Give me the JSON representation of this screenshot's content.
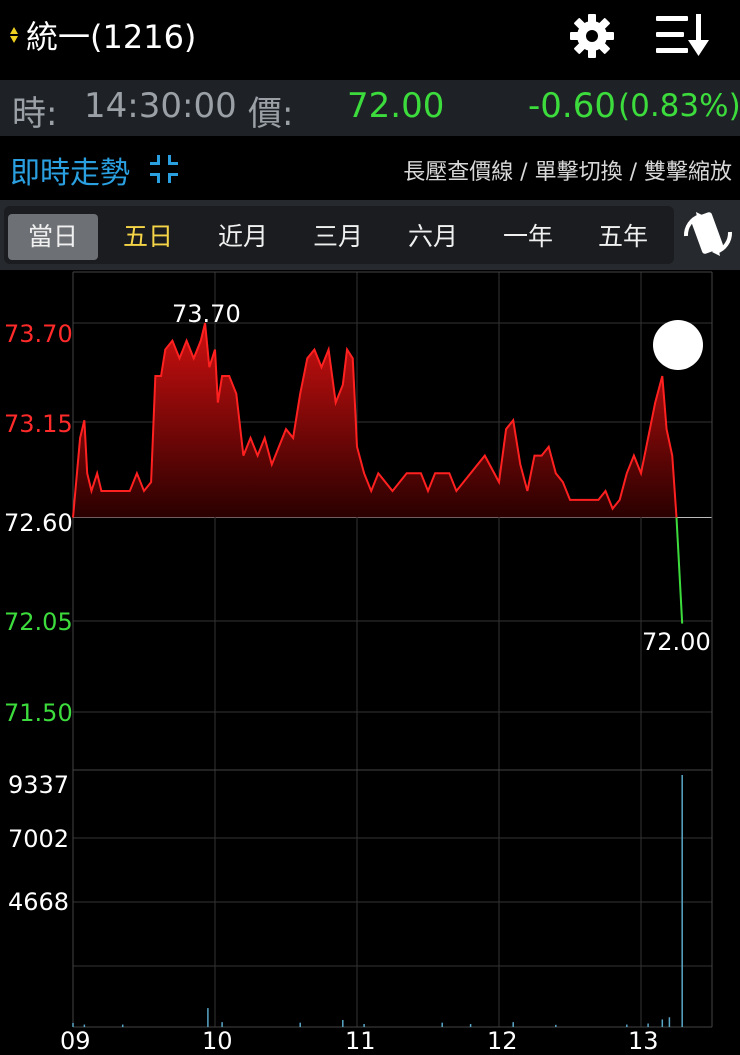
{
  "header": {
    "title": "統一(1216)",
    "icons": {
      "settings": "gear-icon",
      "menu": "sort-list-icon",
      "indicator": "up-down-arrows-icon"
    }
  },
  "quote": {
    "time_label": "時:",
    "time": "14:30:00",
    "price_label": "價:",
    "price": "72.00",
    "change": "-0.60",
    "change_pct": "(0.83%)"
  },
  "mode": {
    "title": "即時走勢",
    "hint": "長壓查價線 / 單擊切換 / 雙擊縮放"
  },
  "tabs": [
    {
      "label": "當日",
      "active": true
    },
    {
      "label": "五日"
    },
    {
      "label": "近月"
    },
    {
      "label": "三月"
    },
    {
      "label": "六月"
    },
    {
      "label": "一年"
    },
    {
      "label": "五年"
    }
  ],
  "colors": {
    "up": "#ff2020",
    "down": "#3ddc3d",
    "ref": "#ffffff",
    "accent": "#2aa0e0",
    "yellow": "#f5d547"
  },
  "chart_data": {
    "type": "line",
    "price_axis": {
      "ticks": [
        "73.70",
        "73.15",
        "72.60",
        "72.05",
        "71.50"
      ],
      "ylim": [
        71.5,
        73.7
      ],
      "reference": 72.6
    },
    "volume_axis": {
      "ticks": [
        "9337",
        "7002",
        "4668"
      ],
      "ylim": [
        0,
        9337
      ]
    },
    "x_ticks": [
      "09",
      "10",
      "11",
      "12",
      "13"
    ],
    "high_label": "73.70",
    "last_label": "72.00",
    "price_series": [
      [
        9.0,
        72.6
      ],
      [
        9.05,
        73.05
      ],
      [
        9.08,
        73.15
      ],
      [
        9.1,
        72.85
      ],
      [
        9.13,
        72.75
      ],
      [
        9.17,
        72.85
      ],
      [
        9.2,
        72.75
      ],
      [
        9.3,
        72.75
      ],
      [
        9.4,
        72.75
      ],
      [
        9.45,
        72.85
      ],
      [
        9.5,
        72.75
      ],
      [
        9.55,
        72.8
      ],
      [
        9.58,
        73.4
      ],
      [
        9.62,
        73.4
      ],
      [
        9.65,
        73.55
      ],
      [
        9.7,
        73.6
      ],
      [
        9.75,
        73.5
      ],
      [
        9.8,
        73.6
      ],
      [
        9.85,
        73.5
      ],
      [
        9.9,
        73.6
      ],
      [
        9.93,
        73.7
      ],
      [
        9.96,
        73.45
      ],
      [
        10.0,
        73.55
      ],
      [
        10.02,
        73.25
      ],
      [
        10.05,
        73.4
      ],
      [
        10.1,
        73.4
      ],
      [
        10.15,
        73.3
      ],
      [
        10.2,
        72.95
      ],
      [
        10.25,
        73.05
      ],
      [
        10.3,
        72.95
      ],
      [
        10.35,
        73.05
      ],
      [
        10.4,
        72.9
      ],
      [
        10.45,
        73.0
      ],
      [
        10.5,
        73.1
      ],
      [
        10.55,
        73.05
      ],
      [
        10.6,
        73.3
      ],
      [
        10.65,
        73.5
      ],
      [
        10.7,
        73.55
      ],
      [
        10.75,
        73.45
      ],
      [
        10.8,
        73.55
      ],
      [
        10.85,
        73.25
      ],
      [
        10.9,
        73.35
      ],
      [
        10.93,
        73.55
      ],
      [
        10.97,
        73.5
      ],
      [
        11.0,
        73.0
      ],
      [
        11.05,
        72.85
      ],
      [
        11.1,
        72.75
      ],
      [
        11.15,
        72.85
      ],
      [
        11.25,
        72.75
      ],
      [
        11.35,
        72.85
      ],
      [
        11.45,
        72.85
      ],
      [
        11.5,
        72.75
      ],
      [
        11.55,
        72.85
      ],
      [
        11.65,
        72.85
      ],
      [
        11.7,
        72.75
      ],
      [
        11.8,
        72.85
      ],
      [
        11.9,
        72.95
      ],
      [
        12.0,
        72.8
      ],
      [
        12.05,
        73.1
      ],
      [
        12.1,
        73.15
      ],
      [
        12.15,
        72.9
      ],
      [
        12.2,
        72.75
      ],
      [
        12.25,
        72.95
      ],
      [
        12.3,
        72.95
      ],
      [
        12.35,
        73.0
      ],
      [
        12.4,
        72.85
      ],
      [
        12.45,
        72.8
      ],
      [
        12.5,
        72.7
      ],
      [
        12.55,
        72.7
      ],
      [
        12.6,
        72.7
      ],
      [
        12.65,
        72.7
      ],
      [
        12.7,
        72.7
      ],
      [
        12.75,
        72.75
      ],
      [
        12.8,
        72.65
      ],
      [
        12.85,
        72.7
      ],
      [
        12.9,
        72.85
      ],
      [
        12.95,
        72.95
      ],
      [
        13.0,
        72.85
      ],
      [
        13.05,
        73.05
      ],
      [
        13.1,
        73.25
      ],
      [
        13.15,
        73.4
      ],
      [
        13.18,
        73.1
      ],
      [
        13.22,
        72.95
      ],
      [
        13.25,
        72.6
      ]
    ],
    "closing_series": [
      [
        13.25,
        72.6
      ],
      [
        13.29,
        72.0
      ]
    ],
    "volume_spikes": [
      [
        9.0,
        150
      ],
      [
        9.08,
        90
      ],
      [
        9.35,
        90
      ],
      [
        9.95,
        700
      ],
      [
        10.05,
        180
      ],
      [
        10.6,
        160
      ],
      [
        10.9,
        260
      ],
      [
        11.05,
        110
      ],
      [
        11.6,
        160
      ],
      [
        11.8,
        110
      ],
      [
        12.1,
        180
      ],
      [
        12.4,
        80
      ],
      [
        12.9,
        90
      ],
      [
        13.05,
        130
      ],
      [
        13.15,
        280
      ],
      [
        13.2,
        360
      ],
      [
        13.29,
        9337
      ]
    ]
  }
}
